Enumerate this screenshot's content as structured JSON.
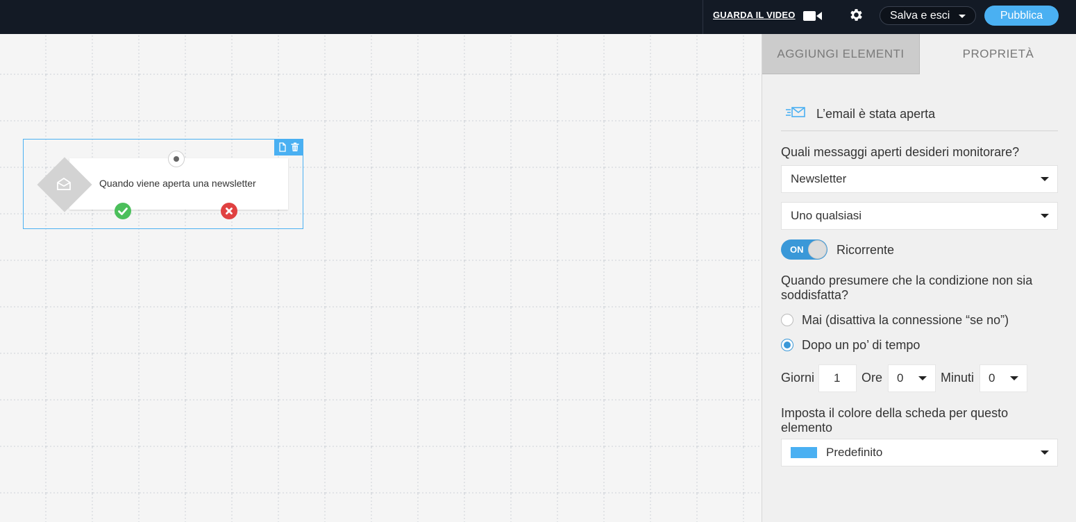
{
  "topbar": {
    "watch_video": "GUARDA IL VIDEO",
    "save_exit": "Salva e esci",
    "publish": "Pubblica"
  },
  "canvas": {
    "node": {
      "label": "Quando viene aperta una newsletter"
    }
  },
  "panel": {
    "tabs": [
      {
        "label": "AGGIUNGI ELEMENTI",
        "active": true
      },
      {
        "label": "PROPRIETÀ",
        "active": false
      }
    ],
    "header_title": "L’email è stata aperta",
    "question_messages": "Quali messaggi aperti desideri monitorare?",
    "message_type_select": "Newsletter",
    "message_select": "Uno qualsiasi",
    "toggle": {
      "state": "ON",
      "label": "Ricorrente"
    },
    "question_condition": "Quando presumere che la condizione non sia soddisfatta?",
    "radio_options": [
      {
        "label": "Mai (disattiva la connessione “se no”)",
        "checked": false
      },
      {
        "label": "Dopo un po’ di tempo",
        "checked": true
      }
    ],
    "duration": {
      "days_label": "Giorni",
      "days_value": "1",
      "hours_label": "Ore",
      "hours_value": "0",
      "minutes_label": "Minuti",
      "minutes_value": "0"
    },
    "color_question": "Imposta il colore della scheda per questo elemento",
    "color_select": "Predefinito"
  },
  "colors": {
    "accent": "#4ab0f2",
    "toggle_on": "#3a98d8",
    "success": "#4bbf5b",
    "danger": "#e04141",
    "topbar": "#131a25"
  }
}
